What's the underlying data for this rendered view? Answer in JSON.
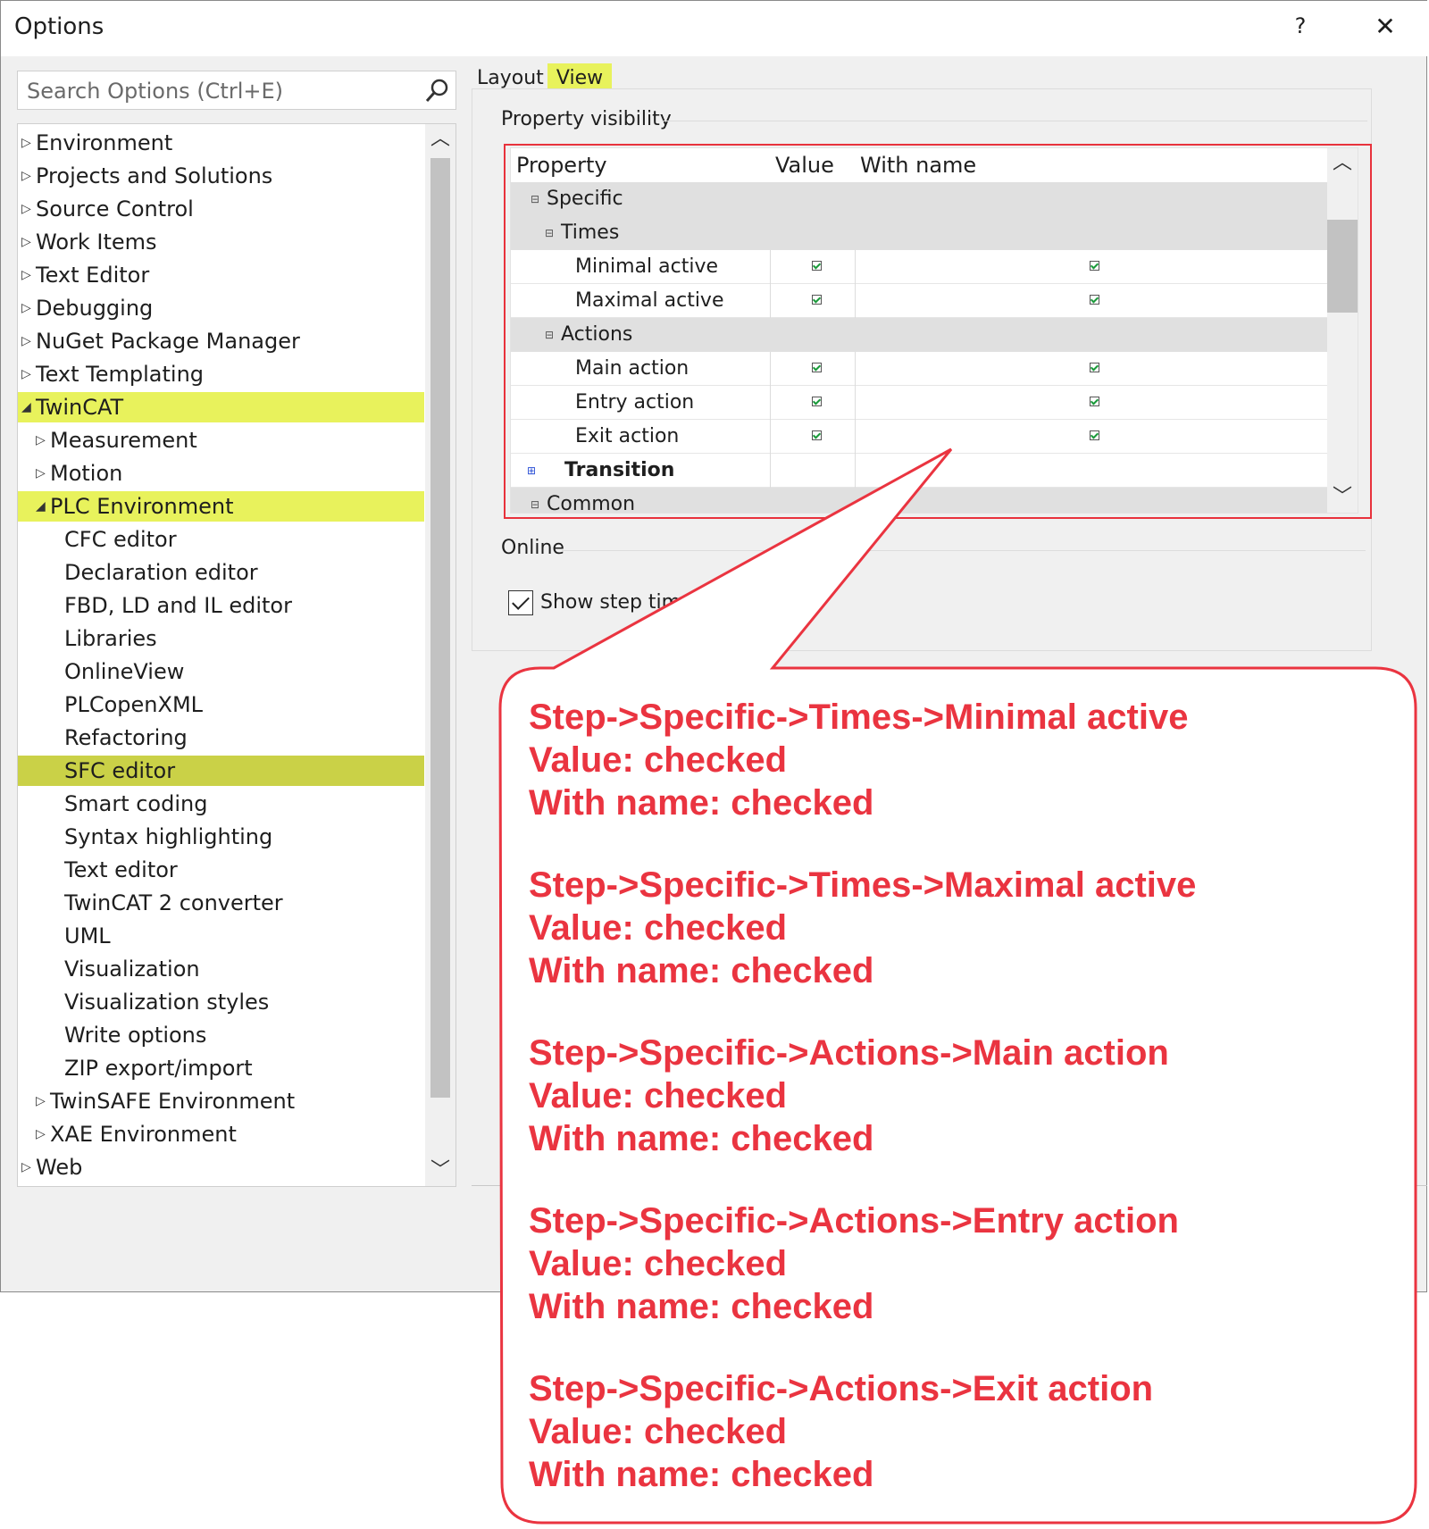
{
  "window": {
    "title": "Options",
    "help_label": "?",
    "close_label": "✕"
  },
  "search": {
    "placeholder": "Search Options (Ctrl+E)",
    "icon": "search-icon"
  },
  "tree": {
    "items": [
      {
        "label": "Environment",
        "level": 0,
        "expanded": false
      },
      {
        "label": "Projects and Solutions",
        "level": 0,
        "expanded": false
      },
      {
        "label": "Source Control",
        "level": 0,
        "expanded": false
      },
      {
        "label": "Work Items",
        "level": 0,
        "expanded": false
      },
      {
        "label": "Text Editor",
        "level": 0,
        "expanded": false
      },
      {
        "label": "Debugging",
        "level": 0,
        "expanded": false
      },
      {
        "label": "NuGet Package Manager",
        "level": 0,
        "expanded": false
      },
      {
        "label": "Text Templating",
        "level": 0,
        "expanded": false
      },
      {
        "label": "TwinCAT",
        "level": 0,
        "expanded": true,
        "highlight": "yellow"
      },
      {
        "label": "Measurement",
        "level": 1,
        "expanded": false
      },
      {
        "label": "Motion",
        "level": 1,
        "expanded": false
      },
      {
        "label": "PLC Environment",
        "level": 1,
        "expanded": true,
        "highlight": "yellow"
      },
      {
        "label": "CFC editor",
        "level": 2
      },
      {
        "label": "Declaration editor",
        "level": 2
      },
      {
        "label": "FBD, LD and IL editor",
        "level": 2
      },
      {
        "label": "Libraries",
        "level": 2
      },
      {
        "label": "OnlineView",
        "level": 2
      },
      {
        "label": "PLCopenXML",
        "level": 2
      },
      {
        "label": "Refactoring",
        "level": 2
      },
      {
        "label": "SFC editor",
        "level": 2,
        "highlight": "selected"
      },
      {
        "label": "Smart coding",
        "level": 2
      },
      {
        "label": "Syntax highlighting",
        "level": 2
      },
      {
        "label": "Text editor",
        "level": 2
      },
      {
        "label": "TwinCAT 2 converter",
        "level": 2
      },
      {
        "label": "UML",
        "level": 2
      },
      {
        "label": "Visualization",
        "level": 2
      },
      {
        "label": "Visualization styles",
        "level": 2
      },
      {
        "label": "Write options",
        "level": 2
      },
      {
        "label": "ZIP export/import",
        "level": 2
      },
      {
        "label": "TwinSAFE Environment",
        "level": 1,
        "expanded": false
      },
      {
        "label": "XAE Environment",
        "level": 1,
        "expanded": false
      },
      {
        "label": "Web",
        "level": 0,
        "expanded": false
      }
    ]
  },
  "tabs": {
    "layout": "Layout",
    "view": "View",
    "active": "View"
  },
  "property_visibility": {
    "group_label": "Property visibility",
    "columns": {
      "property": "Property",
      "value": "Value",
      "with_name": "With name"
    },
    "rows": [
      {
        "label": "Specific",
        "type": "category",
        "indent": 0
      },
      {
        "label": "Times",
        "type": "category",
        "indent": 1
      },
      {
        "label": "Minimal active",
        "type": "item",
        "indent": 2,
        "value": true,
        "with_name": true
      },
      {
        "label": "Maximal active",
        "type": "item",
        "indent": 2,
        "value": true,
        "with_name": true
      },
      {
        "label": "Actions",
        "type": "category",
        "indent": 1
      },
      {
        "label": "Main action",
        "type": "item",
        "indent": 2,
        "value": true,
        "with_name": true
      },
      {
        "label": "Entry action",
        "type": "item",
        "indent": 2,
        "value": true,
        "with_name": true
      },
      {
        "label": "Exit action",
        "type": "item",
        "indent": 2,
        "value": true,
        "with_name": true
      },
      {
        "label": "Transition",
        "type": "collapsed",
        "indent": 0
      },
      {
        "label": "Common",
        "type": "category",
        "indent": 0
      }
    ]
  },
  "online": {
    "group_label": "Online",
    "show_step_time": {
      "label": "Show step time",
      "checked": true
    }
  },
  "callout": {
    "color": "#ea3440",
    "notes": [
      {
        "line1": "Step->Specific->Times->Minimal active",
        "line2": "Value: checked",
        "line3": "With name: checked"
      },
      {
        "line1": "Step->Specific->Times->Maximal active",
        "line2": "Value: checked",
        "line3": "With name: checked"
      },
      {
        "line1": "Step->Specific->Actions->Main action",
        "line2": "Value: checked",
        "line3": "With name: checked"
      },
      {
        "line1": "Step->Specific->Actions->Entry action",
        "line2": "Value: checked",
        "line3": "With name: checked"
      },
      {
        "line1": "Step->Specific->Actions->Exit action",
        "line2": "Value: checked",
        "line3": "With name: checked"
      }
    ]
  }
}
